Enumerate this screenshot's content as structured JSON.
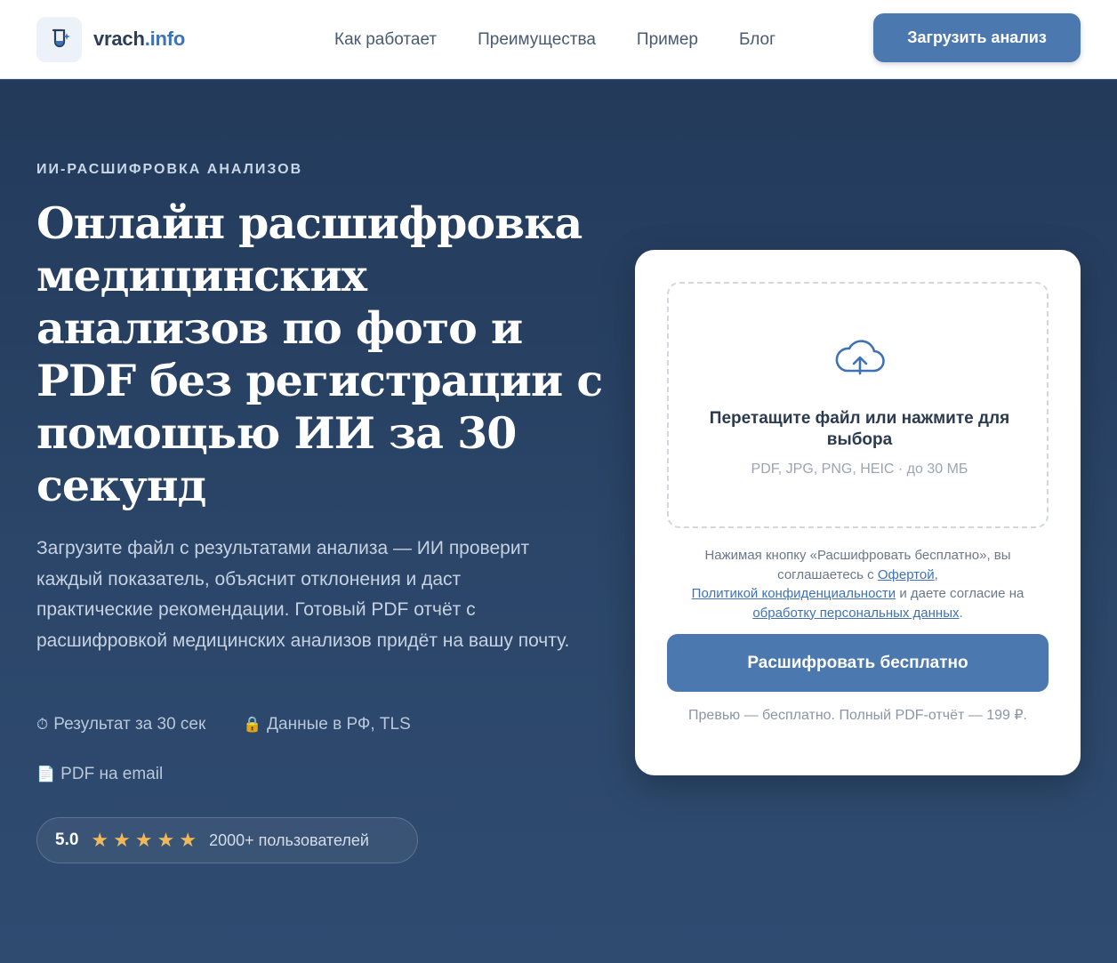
{
  "brand": {
    "name": "vrach",
    "domain": ".info",
    "logo_icon": "flask-sparkle-icon"
  },
  "nav": {
    "items": [
      {
        "label": "Как работает"
      },
      {
        "label": "Преимущества"
      },
      {
        "label": "Пример"
      },
      {
        "label": "Блог"
      }
    ],
    "cta_label": "Загрузить анализ"
  },
  "hero": {
    "eyebrow": "ИИ-РАСШИФРОВКА АНАЛИЗОВ",
    "title": "Онлайн расшифровка медицинских анализов по фото и PDF без регистрации с помощью ИИ за 30 секунд",
    "subtitle": "Загрузите файл с результатами анализа — ИИ проверит каждый показатель, объяснит отклонения и даст практические рекомендации. Готовый PDF отчёт с расшифровкой медицинских анализов придёт на вашу почту.",
    "features": [
      {
        "icon": "stopwatch-icon",
        "glyph": "⏱",
        "label": "Результат за 30 сек"
      },
      {
        "icon": "lock-icon",
        "glyph": "🔒",
        "label": "Данные в РФ, TLS"
      },
      {
        "icon": "document-icon",
        "glyph": "📄",
        "label": "PDF на email"
      }
    ],
    "rating": {
      "score": "5.0",
      "stars": 5,
      "users": "2000+ пользователей"
    }
  },
  "upload_card": {
    "cloud_icon": "cloud-upload-icon",
    "dropzone_title": "Перетащите файл или нажмите для выбора",
    "dropzone_formats": "PDF, JPG, PNG, HEIC · до 30 МБ",
    "consent": {
      "part1": "Нажимая кнопку «Расшифровать бесплатно», вы соглашаетесь с ",
      "link_offer": "Офертой",
      "part2": ",",
      "link_privacy": "Политикой конфиденциальности",
      "part3": " и даете согласие на ",
      "link_personal": "обработку персональных данных",
      "part4": "."
    },
    "cta_label": "Расшифровать бесплатно",
    "note": "Превью — бесплатно. Полный PDF-отчёт — 199 ₽."
  },
  "colors": {
    "accent": "#4c78b0",
    "hero_bg": "#2a4466",
    "star": "#f0b85a"
  }
}
